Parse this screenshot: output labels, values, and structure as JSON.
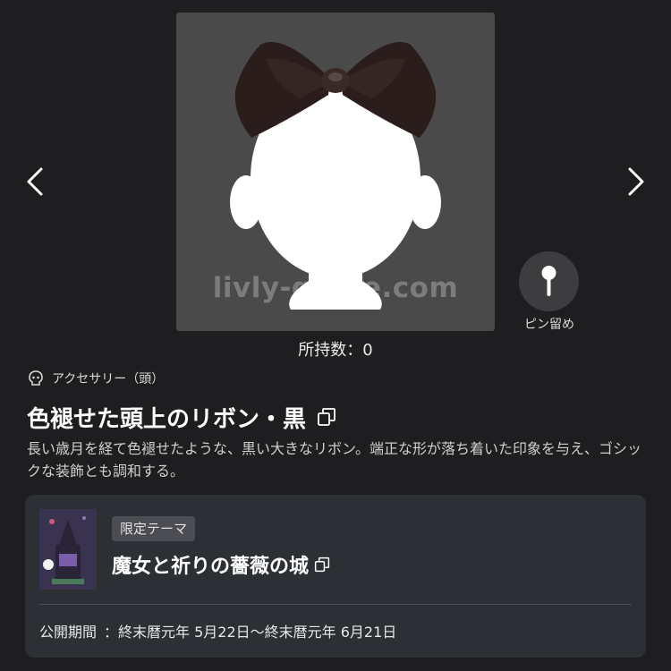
{
  "preview": {
    "watermark": "livly-guide.com"
  },
  "nav": {
    "prev_icon": "chevron-left-icon",
    "next_icon": "chevron-right-icon"
  },
  "pin": {
    "icon": "pin-icon",
    "label": "ピン留め"
  },
  "owned_count_text": "所持数：0",
  "item": {
    "category_icon": "head-icon",
    "category": "アクセサリー（頭）",
    "name": "色褪せた頭上のリボン・黒",
    "copy_icon": "copy-icon",
    "description": "長い歳月を経て色褪せたような、黒い大きなリボン。端正な形が落ち着いた印象を与え、ゴシックな装飾とも調和する。"
  },
  "theme_card": {
    "tag": "限定テーマ",
    "theme_name": "魔女と祈りの薔薇の城",
    "copy_icon": "copy-icon",
    "period_label": "公開期間",
    "period_value": "：終末暦元年 5月22日〜終末暦元年 6月21日"
  },
  "colors": {
    "background": "#1e1e21",
    "preview_bg": "#4a4a4a",
    "card_bg": "#2c2f33",
    "tag_bg": "#4b4d52",
    "ribbon": "#2a1d1b"
  }
}
